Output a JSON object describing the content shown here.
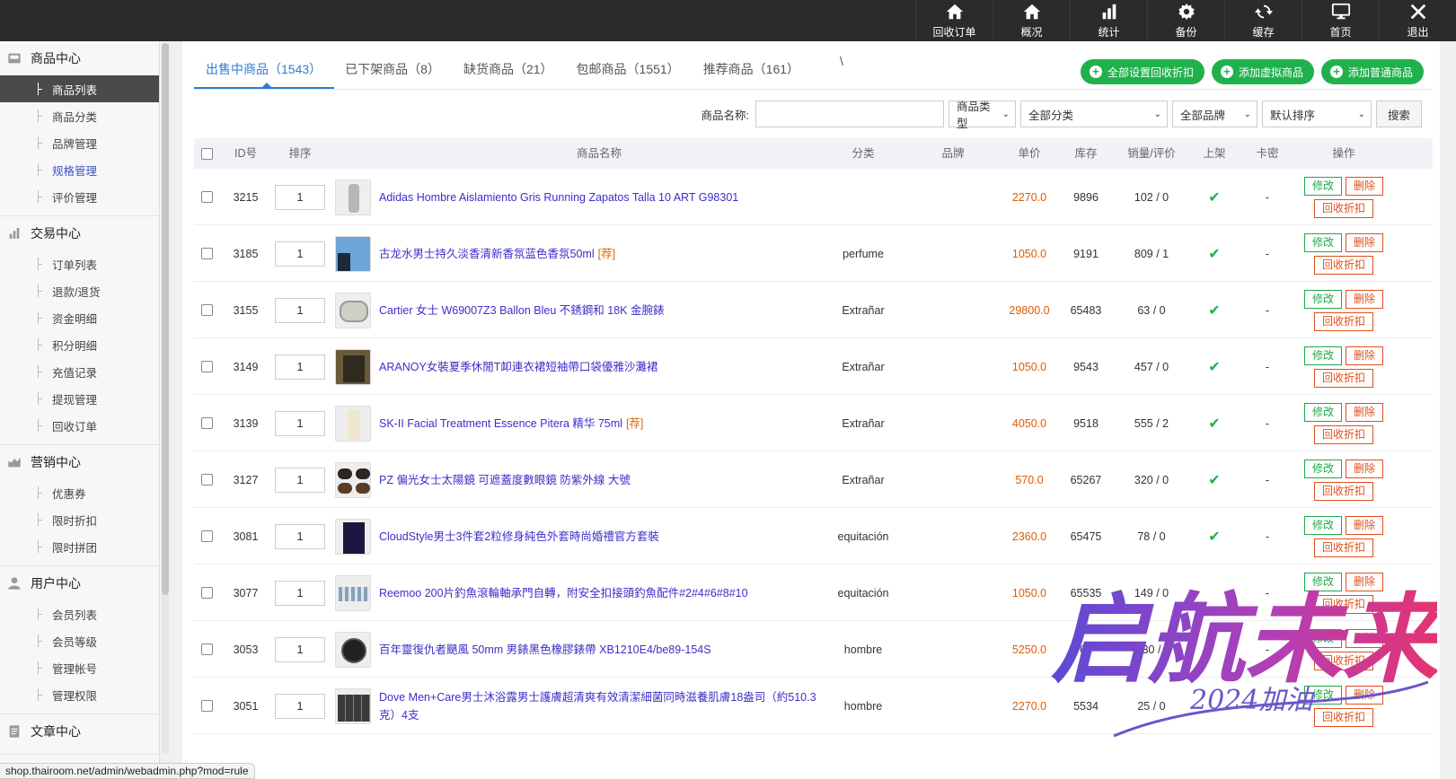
{
  "topnav": [
    {
      "label": "回收订单",
      "icon": "home-icon"
    },
    {
      "label": "概况",
      "icon": "home-icon"
    },
    {
      "label": "统计",
      "icon": "bar-chart-icon"
    },
    {
      "label": "备份",
      "icon": "gear-icon"
    },
    {
      "label": "缓存",
      "icon": "refresh-icon"
    },
    {
      "label": "首页",
      "icon": "monitor-icon"
    },
    {
      "label": "退出",
      "icon": "close-icon"
    }
  ],
  "sidebar": [
    {
      "title": "商品中心",
      "icon": "inbox-icon",
      "items": [
        "商品列表",
        "商品分类",
        "品牌管理",
        "规格管理",
        "评价管理"
      ]
    },
    {
      "title": "交易中心",
      "icon": "bar-chart-icon",
      "items": [
        "订单列表",
        "退款/退货",
        "资金明细",
        "积分明细",
        "充值记录",
        "提现管理",
        "回收订单"
      ]
    },
    {
      "title": "营销中心",
      "icon": "area-chart-icon",
      "items": [
        "优惠券",
        "限时折扣",
        "限时拼团"
      ]
    },
    {
      "title": "用户中心",
      "icon": "user-icon",
      "items": [
        "会员列表",
        "会员等级",
        "管理帐号",
        "管理权限"
      ]
    },
    {
      "title": "文章中心",
      "icon": "document-icon",
      "items": []
    }
  ],
  "tabs": [
    "出售中商品（1543）",
    "已下架商品（8）",
    "缺货商品（21）",
    "包邮商品（1551）",
    "推荐商品（161）"
  ],
  "stray_mark": "\\",
  "actions": {
    "set_recycle": "全部设置回收折扣",
    "add_virtual": "添加虚拟商品",
    "add_normal": "添加普通商品"
  },
  "filter": {
    "name_label": "商品名称:",
    "name_value": "",
    "type_select": "商品类型",
    "category_select": "全部分类",
    "brand_select": "全部品牌",
    "order_select": "默认排序",
    "search_label": "搜索"
  },
  "columns": {
    "id": "ID号",
    "sort": "排序",
    "name": "商品名称",
    "category": "分类",
    "brand": "品牌",
    "price": "单价",
    "stock": "库存",
    "sales": "销量/评价",
    "shelf": "上架",
    "card": "卡密",
    "ops": "操作"
  },
  "row_buttons": {
    "edit": "修改",
    "delete": "删除",
    "recycle": "回收折扣"
  },
  "rows": [
    {
      "id": "3215",
      "sort": "1",
      "name": "Adidas Hombre Aislamiento Gris Running Zapatos Talla 10 ART G98301",
      "rec": "",
      "category": "",
      "brand": "",
      "price": "2270.0",
      "stock": "9896",
      "sales": "102 / 0",
      "shelf": "✔",
      "card": "-"
    },
    {
      "id": "3185",
      "sort": "1",
      "name": "古龙水男士持久淡香清新香氛蓝色香氛50ml",
      "rec": "[荐]",
      "category": "perfume",
      "brand": "",
      "price": "1050.0",
      "stock": "9191",
      "sales": "809 / 1",
      "shelf": "✔",
      "card": "-"
    },
    {
      "id": "3155",
      "sort": "1",
      "name": "Cartier 女士 W69007Z3 Ballon Bleu 不銹鋼和 18K 金腕錶",
      "rec": "",
      "category": "Extrañar",
      "brand": "",
      "price": "29800.0",
      "stock": "65483",
      "sales": "63 / 0",
      "shelf": "✔",
      "card": "-"
    },
    {
      "id": "3149",
      "sort": "1",
      "name": "ARANOY女裝夏季休閒T卹連衣裙短袖帶口袋優雅沙灘裙",
      "rec": "",
      "category": "Extrañar",
      "brand": "",
      "price": "1050.0",
      "stock": "9543",
      "sales": "457 / 0",
      "shelf": "✔",
      "card": "-"
    },
    {
      "id": "3139",
      "sort": "1",
      "name": "SK-II Facial Treatment Essence Pitera 精华 75ml",
      "rec": "[荐]",
      "category": "Extrañar",
      "brand": "",
      "price": "4050.0",
      "stock": "9518",
      "sales": "555 / 2",
      "shelf": "✔",
      "card": "-"
    },
    {
      "id": "3127",
      "sort": "1",
      "name": "PZ 偏光女士太陽鏡 可遮蓋度數眼鏡 防紫外線 大號",
      "rec": "",
      "category": "Extrañar",
      "brand": "",
      "price": "570.0",
      "stock": "65267",
      "sales": "320 / 0",
      "shelf": "✔",
      "card": "-"
    },
    {
      "id": "3081",
      "sort": "1",
      "name": "CloudStyle男士3件套2粒修身純色外套時尚婚禮官方套裝",
      "rec": "",
      "category": "equitación",
      "brand": "",
      "price": "2360.0",
      "stock": "65475",
      "sales": "78 / 0",
      "shelf": "✔",
      "card": "-"
    },
    {
      "id": "3077",
      "sort": "1",
      "name": "Reemoo 200片釣魚滾輪軸承門自轉，附安全扣接頭釣魚配件#2#4#6#8#10",
      "rec": "",
      "category": "equitación",
      "brand": "",
      "price": "1050.0",
      "stock": "65535",
      "sales": "149 / 0",
      "shelf": "",
      "card": "-"
    },
    {
      "id": "3053",
      "sort": "1",
      "name": "百年靈復仇者颶風 50mm 男錶黑色橡膠錶帶 XB1210E4/be89-154S",
      "rec": "",
      "category": "hombre",
      "brand": "",
      "price": "5250.0",
      "stock": "65",
      "sales": "30 /",
      "shelf": "",
      "card": "-"
    },
    {
      "id": "3051",
      "sort": "1",
      "name": "Dove Men+Care男士沐浴露男士護膚超清爽有效清潔細菌同時滋養肌膚18盎司（約510.3克）4支",
      "rec": "",
      "category": "hombre",
      "brand": "",
      "price": "2270.0",
      "stock": "5534",
      "sales": "25 / 0",
      "shelf": "",
      "card": "-"
    }
  ],
  "status_url": "shop.thairoom.net/admin/webadmin.php?mod=rule",
  "watermark": {
    "main": "启航未来",
    "sub": "2024加油"
  }
}
